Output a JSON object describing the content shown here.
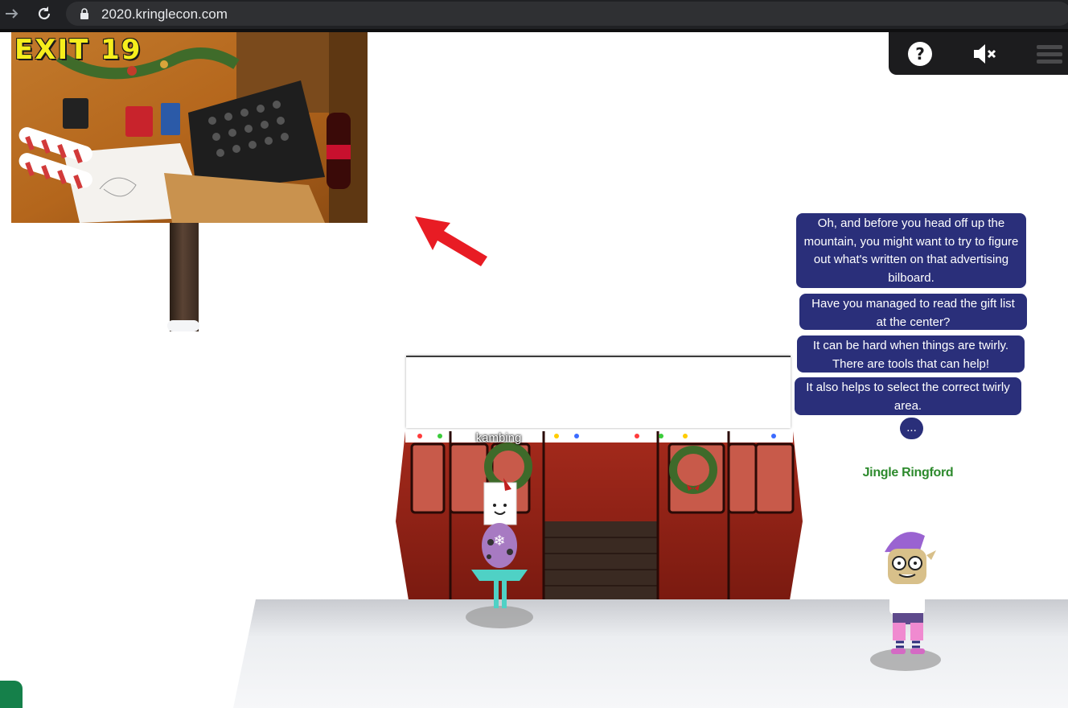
{
  "browser": {
    "url": "2020.kringlecon.com",
    "back_icon": "arrow-right-icon",
    "reload_icon": "reload-icon",
    "lock_icon": "lock-icon"
  },
  "controls": {
    "help_icon": "question-circle-icon",
    "mute_icon": "speaker-mute-icon",
    "menu_icon": "hamburger-menu-icon"
  },
  "billboard": {
    "title": "EXIT 19",
    "title_color": "#f6ee1c"
  },
  "player": {
    "name": "kambing"
  },
  "npc": {
    "name": "Jingle Ringford",
    "name_color": "#2d8a2d"
  },
  "dialog": {
    "messages": [
      "Oh, and before you head off up the mountain, you might want to try to figure out what's written on that advertising bilboard.",
      "Have you managed to read the gift list at the center?",
      "It can be hard when things are twirly. There are tools that can help!",
      "It also helps to select the correct twirly area."
    ],
    "more": "...",
    "bubble_color": "#2a2f7a"
  },
  "colors": {
    "gondola_red": "#8a2016",
    "arrow_red": "#e81c24",
    "snow": "#e9eaee"
  }
}
